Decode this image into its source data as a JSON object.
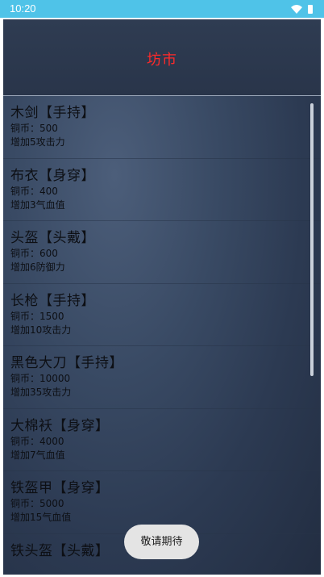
{
  "status_bar": {
    "time": "10:20",
    "icons": [
      "wifi-icon",
      "battery-icon"
    ]
  },
  "header": {
    "title": "坊市",
    "title_color": "#ff2a2a"
  },
  "items": [
    {
      "name": "木剑【手持】",
      "price": "铜币：500",
      "effect": "增加5攻击力"
    },
    {
      "name": "布衣【身穿】",
      "price": "铜币：400",
      "effect": "增加3气血值"
    },
    {
      "name": "头盔【头戴】",
      "price": "铜币：600",
      "effect": "增加6防御力"
    },
    {
      "name": "长枪【手持】",
      "price": "铜币：1500",
      "effect": "增加10攻击力"
    },
    {
      "name": "黑色大刀【手持】",
      "price": "铜币：10000",
      "effect": "增加35攻击力"
    },
    {
      "name": "大棉袄【身穿】",
      "price": "铜币：4000",
      "effect": "增加7气血值"
    },
    {
      "name": "铁盔甲【身穿】",
      "price": "铜币：5000",
      "effect": "增加15气血值"
    },
    {
      "name": "铁头盔【头戴】",
      "price": "",
      "effect": ""
    }
  ],
  "toast": {
    "text": "敬请期待"
  }
}
